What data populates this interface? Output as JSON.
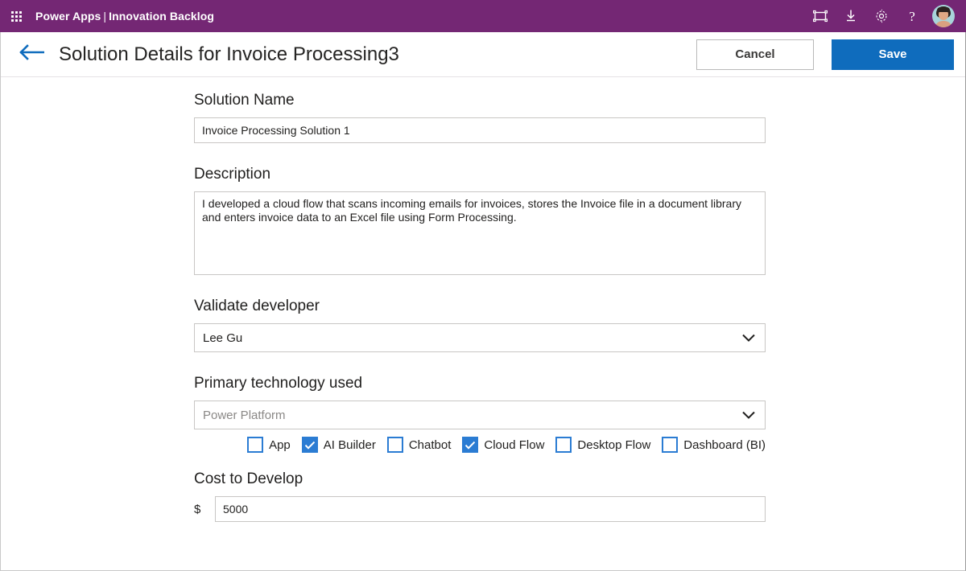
{
  "suite": {
    "waffle_icon": "waffle-grid-icon",
    "brand": "Power Apps",
    "separator": "|",
    "app_name": "Innovation Backlog",
    "actions": [
      {
        "icon": "screen-frame-icon",
        "label": ""
      },
      {
        "icon": "download-icon",
        "label": ""
      },
      {
        "icon": "gear-icon",
        "label": ""
      },
      {
        "icon": "help-icon",
        "label": "?"
      }
    ],
    "avatar": "user-avatar"
  },
  "header": {
    "back_icon": "back-arrow-icon",
    "title": "Solution Details for Invoice Processing3",
    "cancel_label": "Cancel",
    "save_label": "Save"
  },
  "form": {
    "solution_name": {
      "label": "Solution Name",
      "value": "Invoice Processing Solution 1",
      "placeholder": ""
    },
    "description": {
      "label": "Description",
      "value": "I developed a cloud flow that scans incoming emails for invoices, stores the Invoice file in a document library and enters invoice data to an Excel file using Form Processing.",
      "placeholder": ""
    },
    "validate_developer": {
      "label": "Validate developer",
      "value": "Lee Gu",
      "is_placeholder": false,
      "chevron_icon": "chevron-down-icon"
    },
    "primary_technology": {
      "label": "Primary technology used",
      "value": "Power Platform",
      "is_placeholder": true,
      "chevron_icon": "chevron-down-icon"
    },
    "technology_options": [
      {
        "label": "App",
        "checked": false
      },
      {
        "label": "AI Builder",
        "checked": true
      },
      {
        "label": "Chatbot",
        "checked": false
      },
      {
        "label": "Cloud Flow",
        "checked": true
      },
      {
        "label": "Desktop Flow",
        "checked": false
      },
      {
        "label": "Dashboard (BI)",
        "checked": false
      }
    ],
    "cost_to_develop": {
      "label": "Cost to Develop",
      "currency_prefix": "$",
      "value": "5000",
      "placeholder": ""
    }
  },
  "colors": {
    "suite_purple": "#742774",
    "accent_blue": "#0f6cbd",
    "checkbox_blue": "#2b7cd3",
    "border_gray": "#c8c6c4"
  }
}
